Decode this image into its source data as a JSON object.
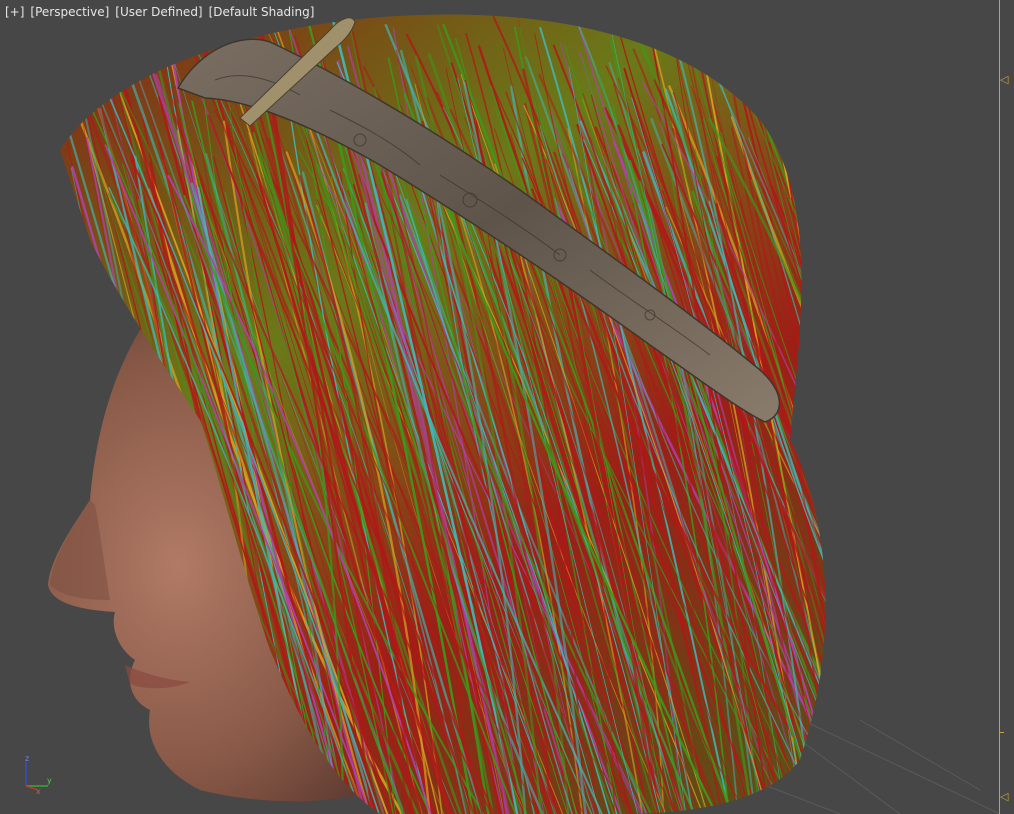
{
  "viewport": {
    "labels": [
      "[+]",
      "[Perspective]",
      "[User Defined]",
      "[Default Shading]"
    ]
  },
  "axis_gizmo": {
    "z_label": "z",
    "y_label": "y",
    "x_label": "x",
    "colors": {
      "x": "#d03030",
      "y": "#30c030",
      "z": "#3050e0"
    }
  },
  "timeline": {
    "accent_color": "#c9a23a",
    "markers": [
      {
        "name": "time-marker-top-icon",
        "glyph": "◁"
      },
      {
        "name": "time-marker-bottom-icon",
        "glyph": "◁"
      }
    ]
  },
  "colors": {
    "background": "#474747",
    "label_text": "#e6e6e6",
    "hair_red": "#b01818",
    "hair_green": "#3a9a1a",
    "hair_yellow": "#d8a020",
    "hair_cyan": "#3fb8b8",
    "hair_magenta": "#b040b0",
    "skin": "#a07060",
    "headband": "#6e6358"
  }
}
